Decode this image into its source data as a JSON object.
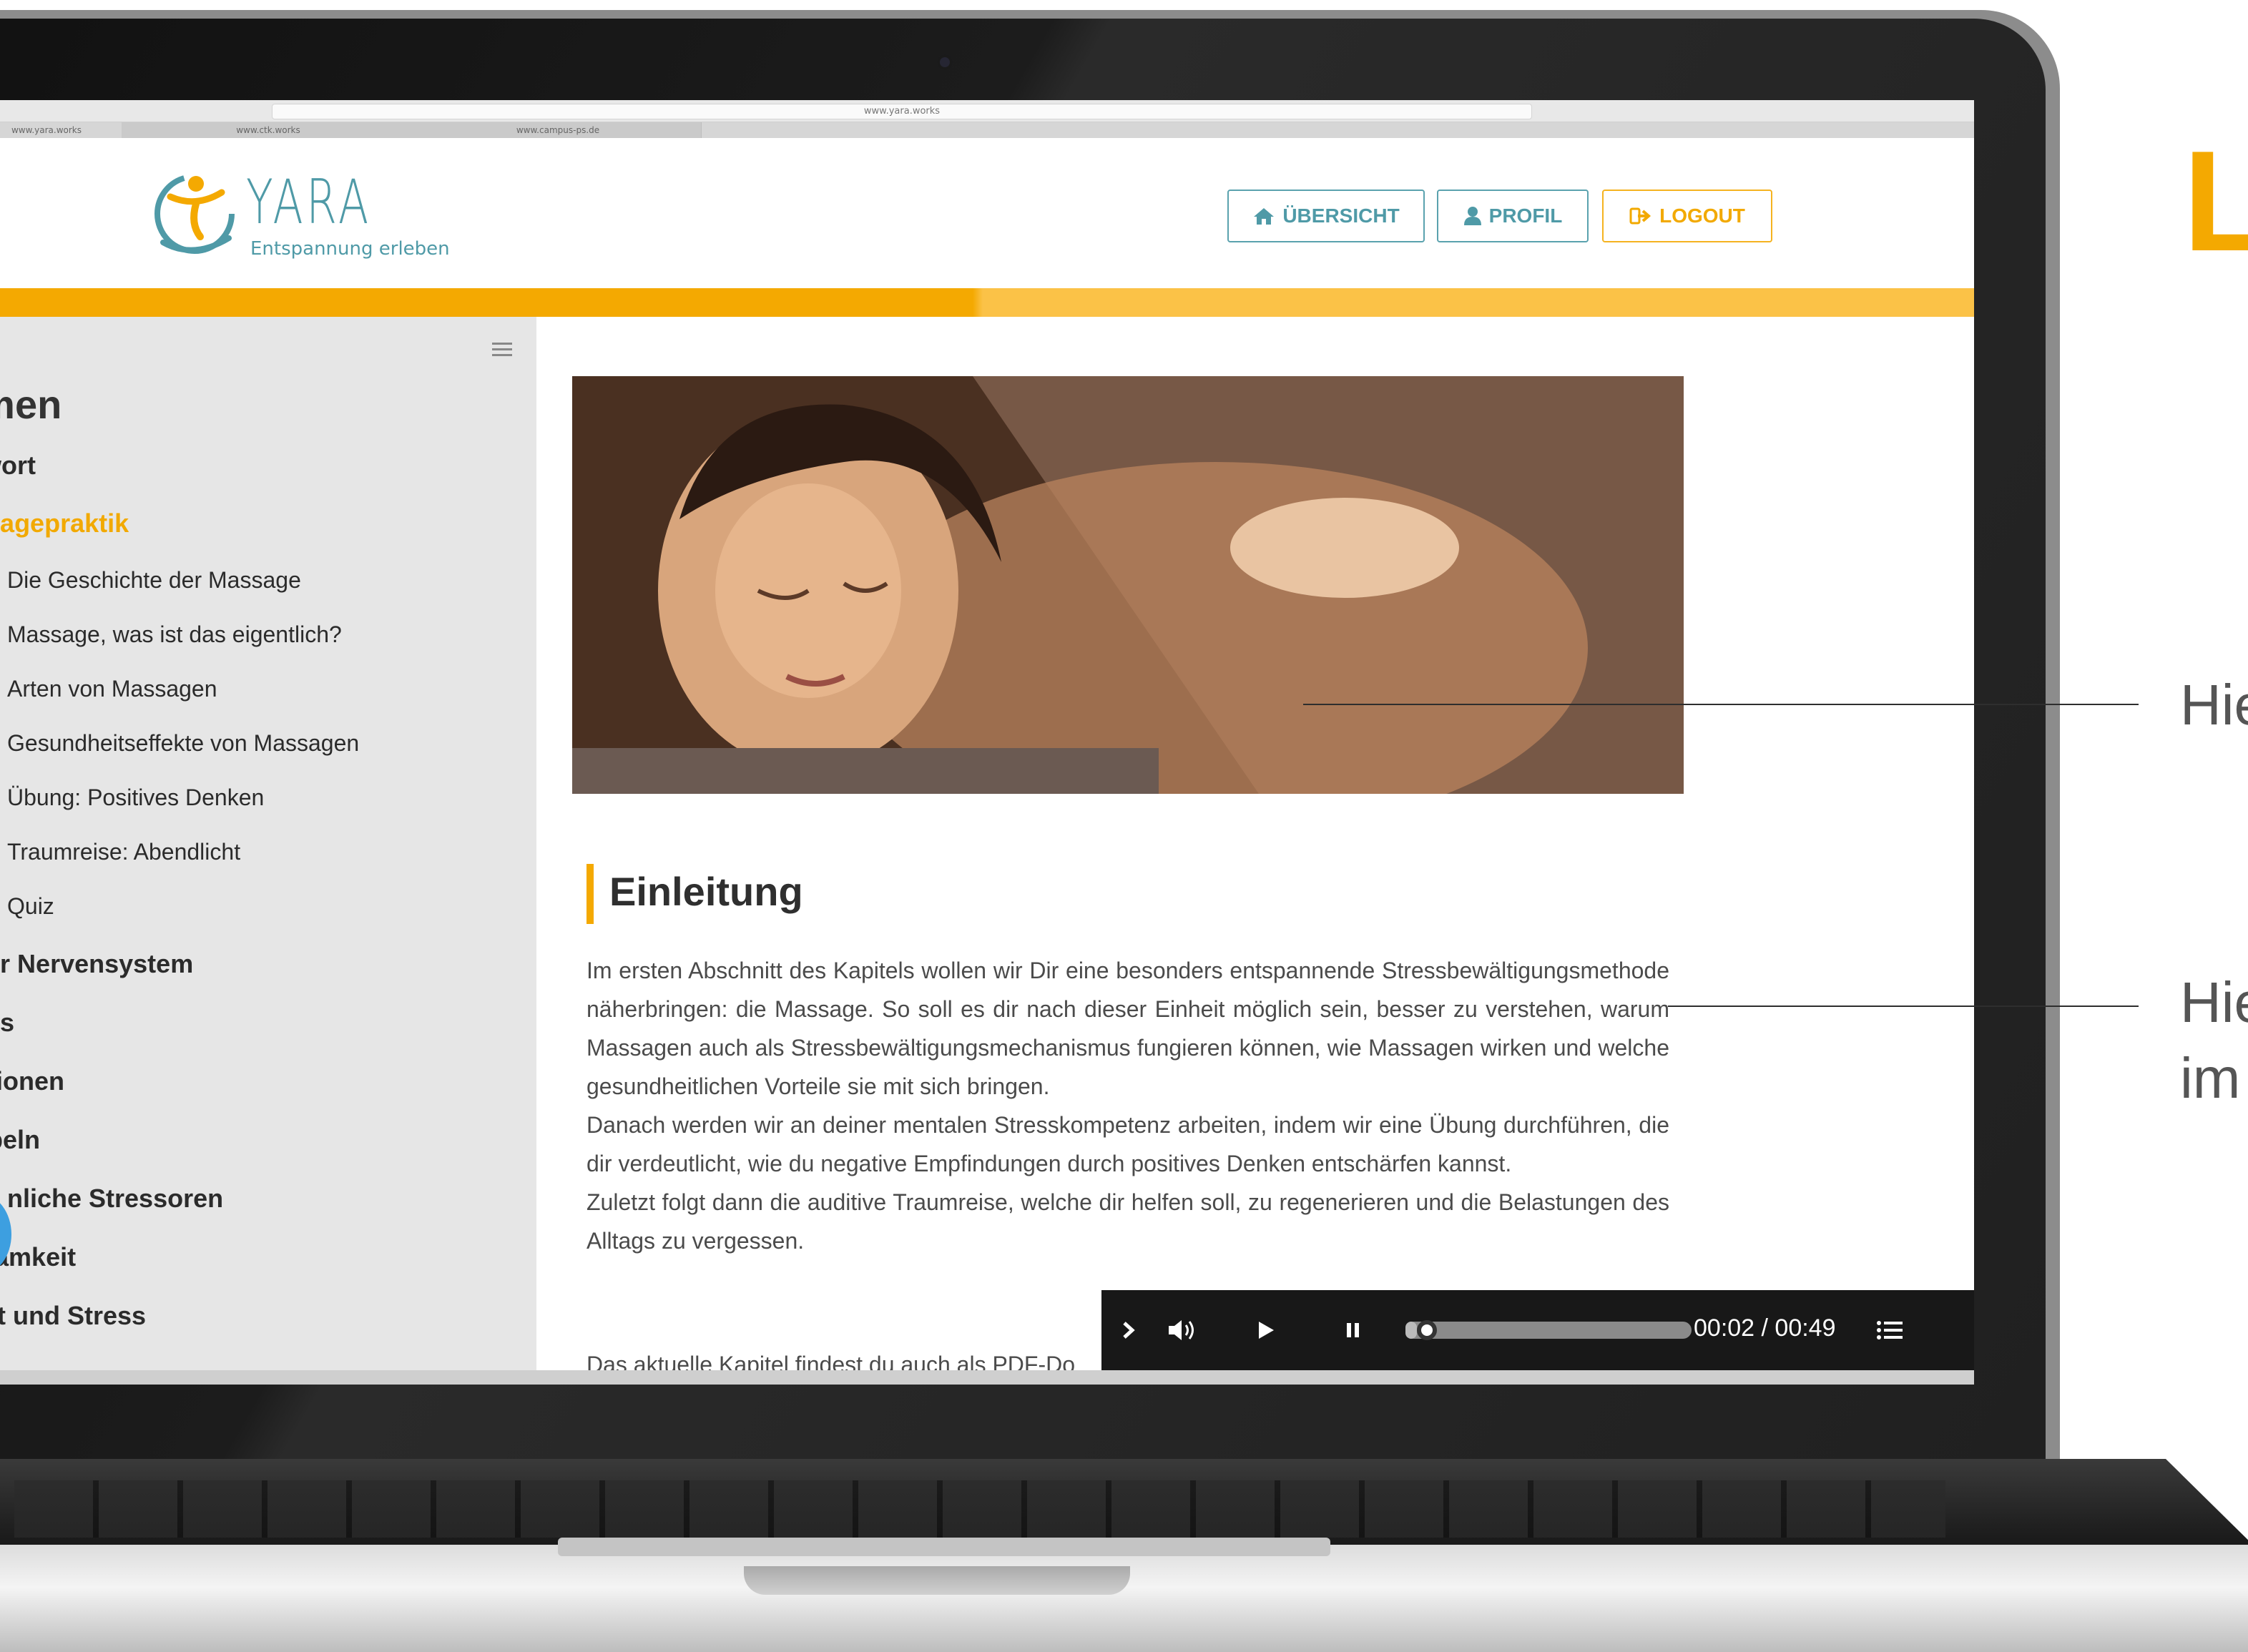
{
  "browser": {
    "url": "www.yara.works",
    "tabs": [
      "www.yara.works",
      "www.ctk.works",
      "www.campus-ps.de"
    ]
  },
  "header": {
    "logo_text": "YARA",
    "tagline": "Entspannung erleben",
    "nav": {
      "overview_label": "ÜBERSICHT",
      "profile_label": "PROFIL",
      "logout_label": "LOGOUT"
    }
  },
  "sidebar": {
    "heading": "emen",
    "chapters": [
      {
        "label": "rwort",
        "active": false
      },
      {
        "label": "ssagepraktik",
        "active": true
      },
      {
        "label": "ser Nervensystem",
        "active": false
      },
      {
        "label": "ess",
        "active": false
      },
      {
        "label": "otionen",
        "active": false
      },
      {
        "label": "übeln",
        "active": false
      },
      {
        "label": "nliche Stressoren",
        "active": false
      },
      {
        "label": "tsamkeit",
        "active": false
      },
      {
        "label": "ort und Stress",
        "active": false
      }
    ],
    "subitems": [
      "Die Geschichte der Massage",
      "Massage, was ist das eigentlich?",
      "Arten von Massagen",
      "Gesundheitseffekte von Massagen",
      "Übung: Positives Denken",
      "Traumreise: Abendlicht",
      "Quiz"
    ]
  },
  "content": {
    "section_title": "Einleitung",
    "paragraphs": [
      "Im ersten Abschnitt des Kapitels wollen wir Dir eine besonders entspannende Stressbewältigungsmethode näherbringen: die Massage. So soll es dir nach dieser Einheit möglich sein, besser zu verstehen, warum Massagen auch als Stressbewältigungsmechanismus fungieren können, wie Massagen wirken und welche gesundheitlichen Vorteile sie mit sich bringen.",
      "Danach werden wir an deiner mentalen Stresskompetenz arbeiten, indem wir eine Übung durchführen, die dir verdeutlicht, wie du negative Empfindungen durch positives Denken entschärfen kannst.",
      "Zuletzt folgt dann die auditive Traumreise, welche dir helfen soll, zu regenerieren und die Belastungen des Alltags zu vergessen."
    ],
    "cut_off_line": "Das aktuelle Kapitel findest du auch als PDF-Do"
  },
  "player": {
    "time": "00:02 / 00:49",
    "progress": 0.04
  },
  "annotations": {
    "callout_1": "Hie",
    "callout_2a": "Hie",
    "callout_2b": "im",
    "corner": "L"
  },
  "colors": {
    "accent_orange": "#f4a901",
    "brand_teal": "#4f9aa7",
    "player_bg": "#181818"
  }
}
